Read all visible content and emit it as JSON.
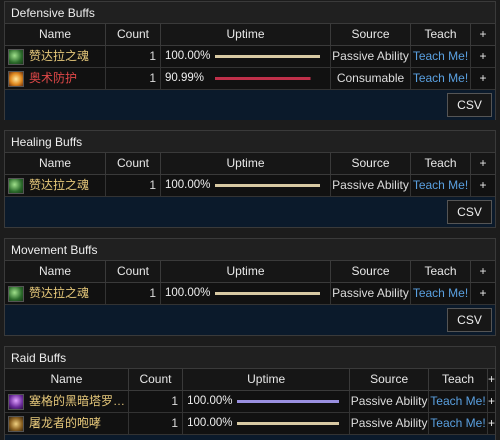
{
  "headers": {
    "name": "Name",
    "count": "Count",
    "uptime": "Uptime",
    "source": "Source",
    "teach": "Teach",
    "plus": "+"
  },
  "csv_label": "CSV",
  "panels": [
    {
      "title": "Defensive Buffs",
      "rows": [
        {
          "name": "赞达拉之魂",
          "count": "1",
          "uptime": "100.00%",
          "uptime_fraction": 1.0,
          "bar_color": "#d8c9a3",
          "source": "Passive Ability",
          "teach": "Teach Me!",
          "plus": "+",
          "name_color": "#e6c87a",
          "icon": "green-spirit-icon"
        },
        {
          "name": "奥术防护",
          "count": "1",
          "uptime": "90.99%",
          "uptime_fraction": 0.9099,
          "bar_color": "#c0304a",
          "source": "Consumable",
          "teach": "Teach Me!",
          "plus": "+",
          "name_color": "#e04848",
          "icon": "orange-flask-icon"
        }
      ]
    },
    {
      "title": "Healing Buffs",
      "rows": [
        {
          "name": "赞达拉之魂",
          "count": "1",
          "uptime": "100.00%",
          "uptime_fraction": 1.0,
          "bar_color": "#d8c9a3",
          "source": "Passive Ability",
          "teach": "Teach Me!",
          "plus": "+",
          "name_color": "#e6c87a",
          "icon": "green-spirit-icon"
        }
      ]
    },
    {
      "title": "Movement Buffs",
      "rows": [
        {
          "name": "赞达拉之魂",
          "count": "1",
          "uptime": "100.00%",
          "uptime_fraction": 1.0,
          "bar_color": "#d8c9a3",
          "source": "Passive Ability",
          "teach": "Teach Me!",
          "plus": "+",
          "name_color": "#e6c87a",
          "icon": "green-spirit-icon"
        }
      ]
    },
    {
      "title": "Raid Buffs",
      "rows": [
        {
          "name": "塞格的黑暗塔罗…",
          "count": "1",
          "uptime": "100.00%",
          "uptime_fraction": 1.0,
          "bar_color": "#9a90e0",
          "source": "Passive Ability",
          "teach": "Teach Me!",
          "plus": "+",
          "name_color": "#e6c87a",
          "icon": "purple-card-icon"
        },
        {
          "name": "屠龙者的咆哮",
          "count": "1",
          "uptime": "100.00%",
          "uptime_fraction": 1.0,
          "bar_color": "#d8c9a3",
          "source": "Passive Ability",
          "teach": "Teach Me!",
          "plus": "+",
          "name_color": "#e6c87a",
          "icon": "gold-dragon-icon"
        }
      ]
    }
  ]
}
